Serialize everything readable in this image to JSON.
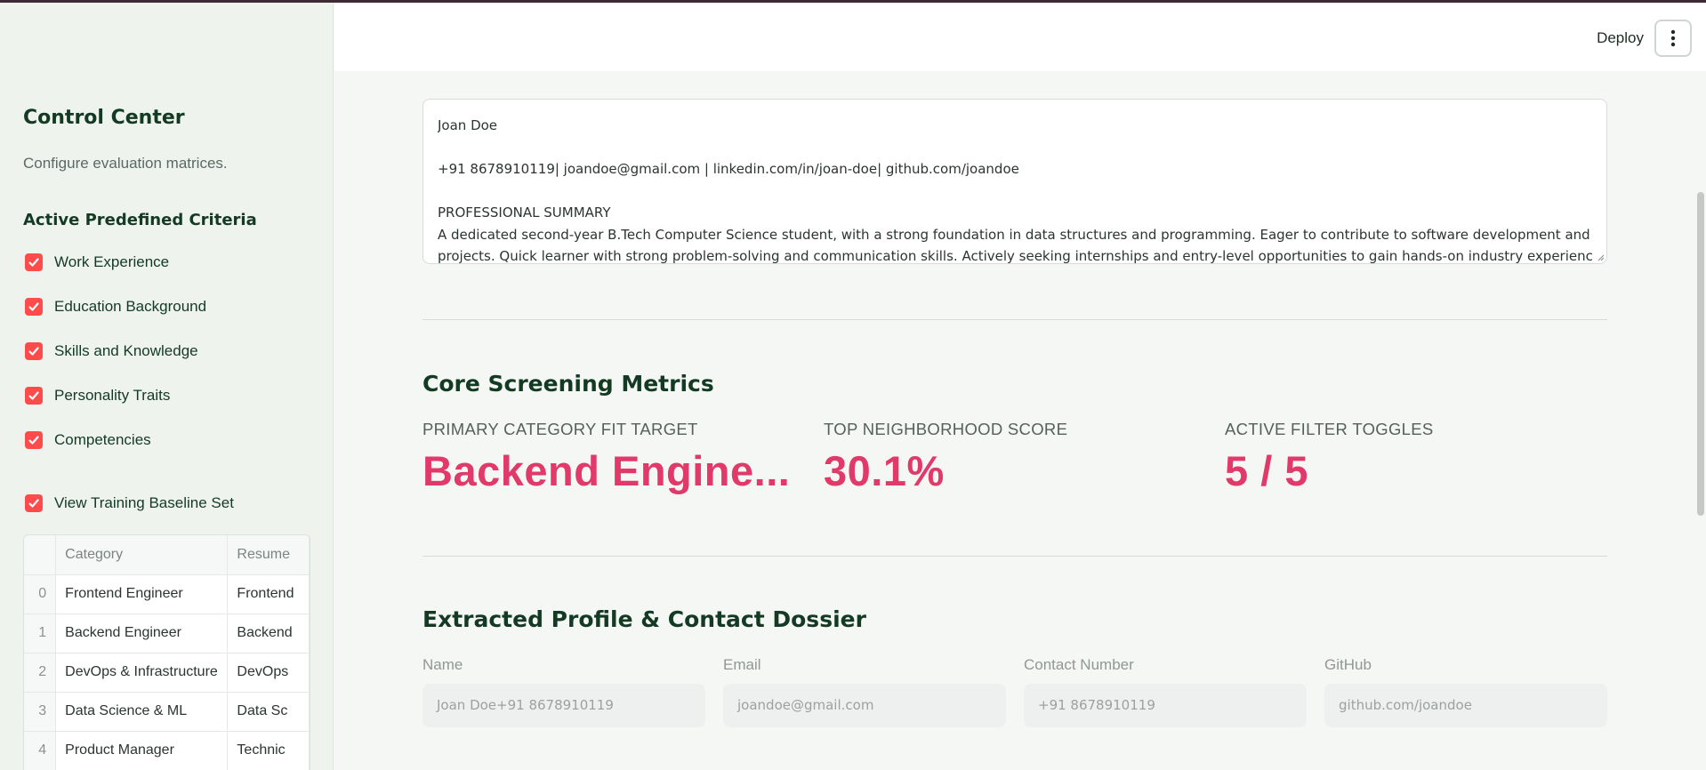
{
  "sidebar": {
    "title": "Control Center",
    "subtitle": "Configure evaluation matrices.",
    "section_title": "Active Predefined Criteria",
    "criteria": [
      {
        "label": "Work Experience",
        "checked": true
      },
      {
        "label": "Education Background",
        "checked": true
      },
      {
        "label": "Skills and Knowledge",
        "checked": true
      },
      {
        "label": "Personality Traits",
        "checked": true
      },
      {
        "label": "Competencies",
        "checked": true
      }
    ],
    "baseline_toggle": {
      "label": "View Training Baseline Set",
      "checked": true
    },
    "table": {
      "columns": [
        "",
        "Category",
        "Resume"
      ],
      "rows": [
        {
          "index": "0",
          "category": "Frontend Engineer",
          "resume": "Frontend"
        },
        {
          "index": "1",
          "category": "Backend Engineer",
          "resume": "Backend"
        },
        {
          "index": "2",
          "category": "DevOps & Infrastructure",
          "resume": "DevOps"
        },
        {
          "index": "3",
          "category": "Data Science & ML",
          "resume": "Data Sc"
        },
        {
          "index": "4",
          "category": "Product Manager",
          "resume": "Technic"
        }
      ]
    }
  },
  "header": {
    "deploy_label": "Deploy",
    "menu_icon": "more-vertical-icon"
  },
  "resume_text": [
    "Joan Doe",
    "",
    "+91 8678910119| joandoe@gmail.com | linkedin.com/in/joan-doe| github.com/joandoe",
    "",
    "PROFESSIONAL SUMMARY",
    "A dedicated second-year B.Tech Computer Science student, with a strong foundation in data structures and programming. Eager to contribute to software development and IoT",
    "projects. Quick learner with strong problem-solving and communication skills. Actively seeking internships and entry-level opportunities to gain hands-on industry experience"
  ],
  "metrics": {
    "section_title": "Core Screening Metrics",
    "items": [
      {
        "label": "PRIMARY CATEGORY FIT TARGET",
        "value": "Backend Engine..."
      },
      {
        "label": "TOP NEIGHBORHOOD SCORE",
        "value": "30.1%"
      },
      {
        "label": "ACTIVE FILTER TOGGLES",
        "value": "5 / 5"
      }
    ]
  },
  "profile": {
    "section_title": "Extracted Profile & Contact Dossier",
    "fields": [
      {
        "label": "Name",
        "value": "Joan Doe+91 8678910119"
      },
      {
        "label": "Email",
        "value": "joandoe@gmail.com"
      },
      {
        "label": "Contact Number",
        "value": "+91 8678910119"
      },
      {
        "label": "GitHub",
        "value": "github.com/joandoe"
      }
    ]
  },
  "colors": {
    "accent": "#e0396a",
    "checkbox": "#ff4b4b",
    "heading": "#143a24"
  }
}
